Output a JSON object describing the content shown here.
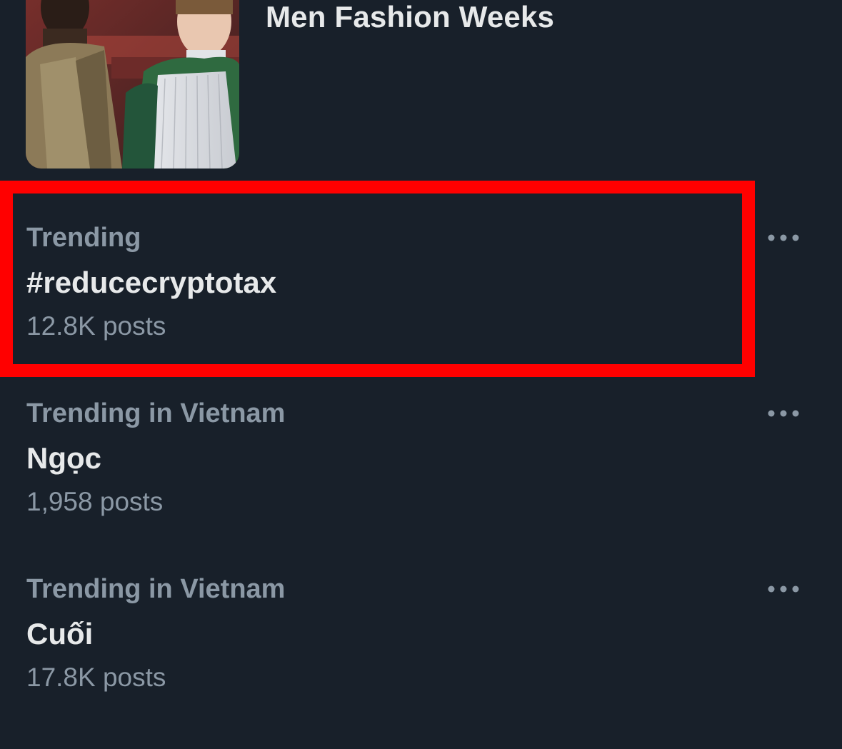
{
  "event": {
    "title": "Men Fashion Weeks",
    "thumbnail_icon": "fashion-photo"
  },
  "trends": [
    {
      "context": "Trending",
      "name": "#reducecryptotax",
      "posts": "12.8K posts",
      "highlighted": true,
      "more_icon": "more-horizontal-icon"
    },
    {
      "context": "Trending in Vietnam",
      "name": "Ngọc",
      "posts": "1,958 posts",
      "highlighted": false,
      "more_icon": "more-horizontal-icon"
    },
    {
      "context": "Trending in Vietnam",
      "name": "Cuối",
      "posts": "17.8K posts",
      "highlighted": false,
      "more_icon": "more-horizontal-icon"
    }
  ],
  "colors": {
    "background": "#18202a",
    "primary_text": "#e7e9ea",
    "secondary_text": "#8b98a5",
    "highlight": "#ff0000"
  }
}
